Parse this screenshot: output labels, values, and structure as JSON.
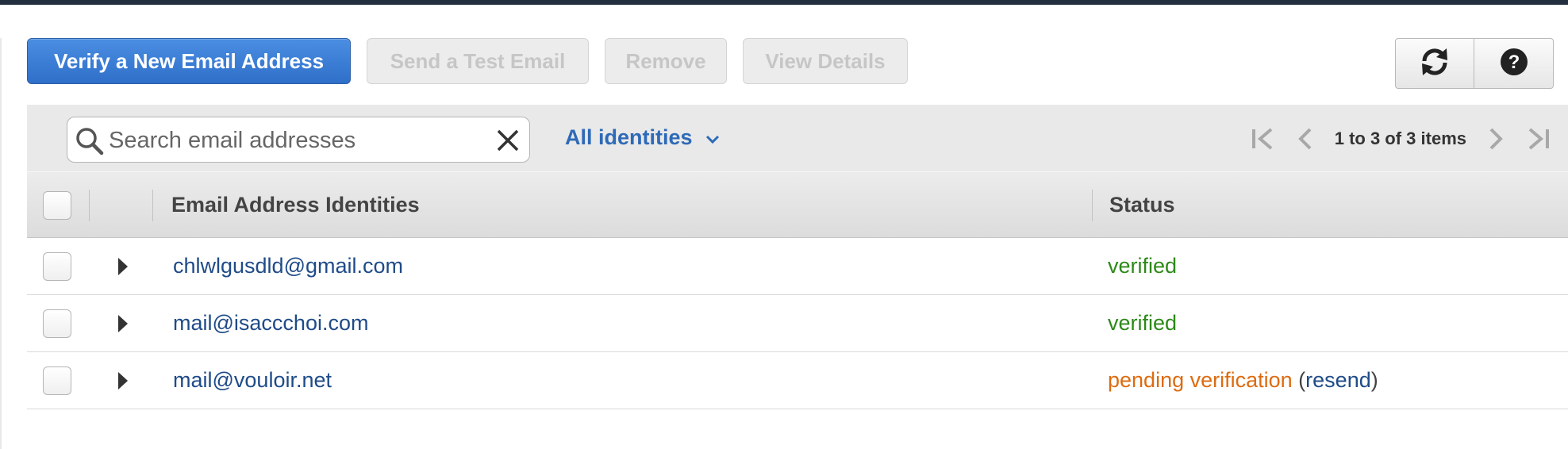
{
  "toolbar": {
    "verify_label": "Verify a New Email Address",
    "send_test_label": "Send a Test Email",
    "remove_label": "Remove",
    "view_details_label": "View Details"
  },
  "icons": {
    "refresh": "refresh-icon",
    "help": "help-icon",
    "search": "search-icon",
    "clear": "close-icon",
    "filter": "chevron-down-icon",
    "expand": "triangle-right-icon"
  },
  "search": {
    "placeholder": "Search email addresses",
    "value": ""
  },
  "filter": {
    "selected": "All identities"
  },
  "pager": {
    "text": "1 to 3 of 3 items"
  },
  "table": {
    "columns": [
      "Email Address Identities",
      "Status"
    ],
    "rows": [
      {
        "email": "chlwlgusdld@gmail.com",
        "status": "verified",
        "action": ""
      },
      {
        "email": "mail@isaccchoi.com",
        "status": "verified",
        "action": ""
      },
      {
        "email": "mail@vouloir.net",
        "status": "pending verification",
        "action": "resend"
      }
    ]
  },
  "colors": {
    "primary": "#2f6fc9",
    "link": "#1f4b88",
    "verified": "#2d8a18",
    "pending": "#dd6b10",
    "topbar": "#232f3e"
  }
}
